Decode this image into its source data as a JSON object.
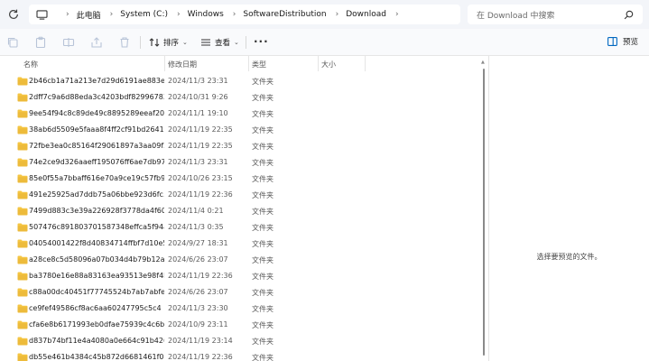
{
  "address": {
    "crumbs": [
      "此电脑",
      "System (C:)",
      "Windows",
      "SoftwareDistribution",
      "Download"
    ],
    "search_placeholder": "在 Download 中搜索"
  },
  "toolbar": {
    "sort_label": "排序",
    "view_label": "查看",
    "preview_label": "预览"
  },
  "columns": {
    "name": "名称",
    "date": "修改日期",
    "type": "类型",
    "size": "大小"
  },
  "files": [
    {
      "name": "2b46cb1a71a213e7d29d6191ae883e...",
      "date": "2024/11/3 23:31",
      "type": "文件夹"
    },
    {
      "name": "2dff7c9a6d88eda3c4203bdf82996783",
      "date": "2024/10/31 9:26",
      "type": "文件夹"
    },
    {
      "name": "9ee54f94c8c89de49c8895289eeaf204",
      "date": "2024/11/1 19:10",
      "type": "文件夹"
    },
    {
      "name": "38ab6d5509e5faaa8f4ff2cf91bd2641",
      "date": "2024/11/19 22:35",
      "type": "文件夹"
    },
    {
      "name": "72fbe3ea0c85164f29061897a3aa09f3",
      "date": "2024/11/19 22:35",
      "type": "文件夹"
    },
    {
      "name": "74e2ce9d326aaeff195076ff6ae7db97",
      "date": "2024/11/3 23:31",
      "type": "文件夹"
    },
    {
      "name": "85e0f55a7bbaff616e70a9ce19c57fb9",
      "date": "2024/10/26 23:15",
      "type": "文件夹"
    },
    {
      "name": "491e25925ad7ddb75a06bbe923d6fc...",
      "date": "2024/11/19 22:36",
      "type": "文件夹"
    },
    {
      "name": "7499d883c3e39a226928f3778da4f602",
      "date": "2024/11/4 0:21",
      "type": "文件夹"
    },
    {
      "name": "507476c891803701587348effca5f94a",
      "date": "2024/11/3 0:35",
      "type": "文件夹"
    },
    {
      "name": "04054001422f8d40834714ffbf7d10e5",
      "date": "2024/9/27 18:31",
      "type": "文件夹"
    },
    {
      "name": "a28ce8c5d58096a07b034d4b79b12a...",
      "date": "2024/6/26 23:07",
      "type": "文件夹"
    },
    {
      "name": "ba3780e16e88a83163ea93513e98f4be",
      "date": "2024/11/19 22:36",
      "type": "文件夹"
    },
    {
      "name": "c88a00dc40451f77745524b7ab7abfe5",
      "date": "2024/6/26 23:07",
      "type": "文件夹"
    },
    {
      "name": "ce9fef49586cf8ac6aa60247795c5c4",
      "date": "2024/11/3 23:30",
      "type": "文件夹"
    },
    {
      "name": "cfa6e8b6171993eb0dfae75939c4c6b8",
      "date": "2024/10/9 23:11",
      "type": "文件夹"
    },
    {
      "name": "d837b74bf11e4a4080a0e664c91b426a",
      "date": "2024/11/19 23:14",
      "type": "文件夹"
    },
    {
      "name": "db55e461b4384c45b872d6681461f0",
      "date": "2024/11/19 22:36",
      "type": "文件夹"
    }
  ],
  "preview": {
    "message": "选择要预览的文件。"
  },
  "colors": {
    "folder": "#f5c542",
    "folder_dark": "#e0a82e",
    "accent": "#0067c0"
  }
}
